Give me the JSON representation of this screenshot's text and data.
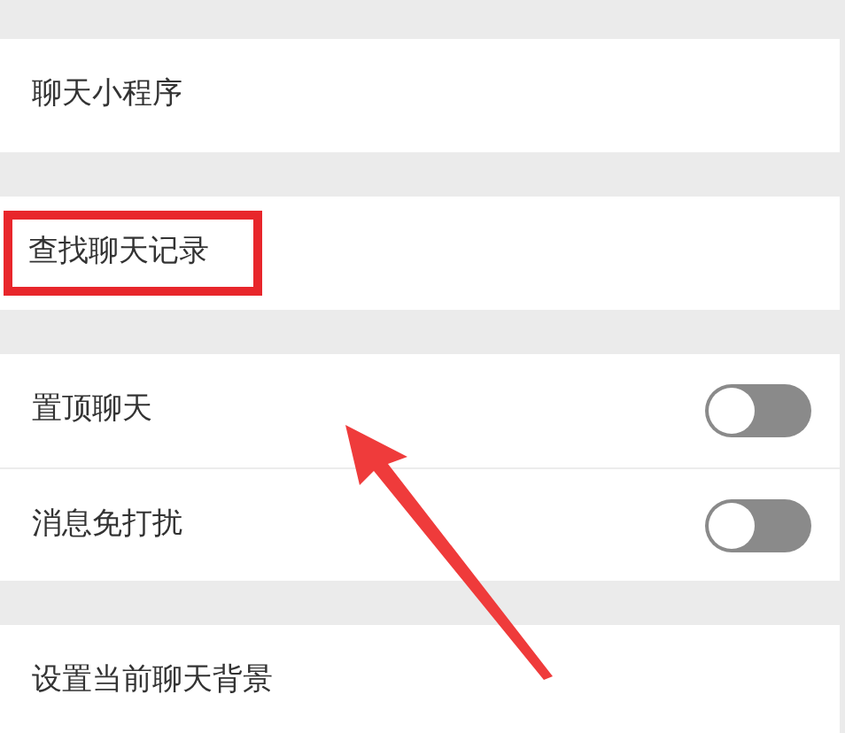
{
  "sections": [
    {
      "items": [
        {
          "kind": "link",
          "label": "聊天小程序",
          "highlighted": false
        }
      ]
    },
    {
      "items": [
        {
          "kind": "link",
          "label": "查找聊天记录",
          "highlighted": true
        }
      ]
    },
    {
      "items": [
        {
          "kind": "toggle",
          "label": "置顶聊天",
          "on": false,
          "highlighted": false
        },
        {
          "kind": "toggle",
          "label": "消息免打扰",
          "on": false,
          "highlighted": false
        }
      ]
    },
    {
      "items": [
        {
          "kind": "link",
          "label": "设置当前聊天背景",
          "highlighted": false
        }
      ]
    }
  ]
}
